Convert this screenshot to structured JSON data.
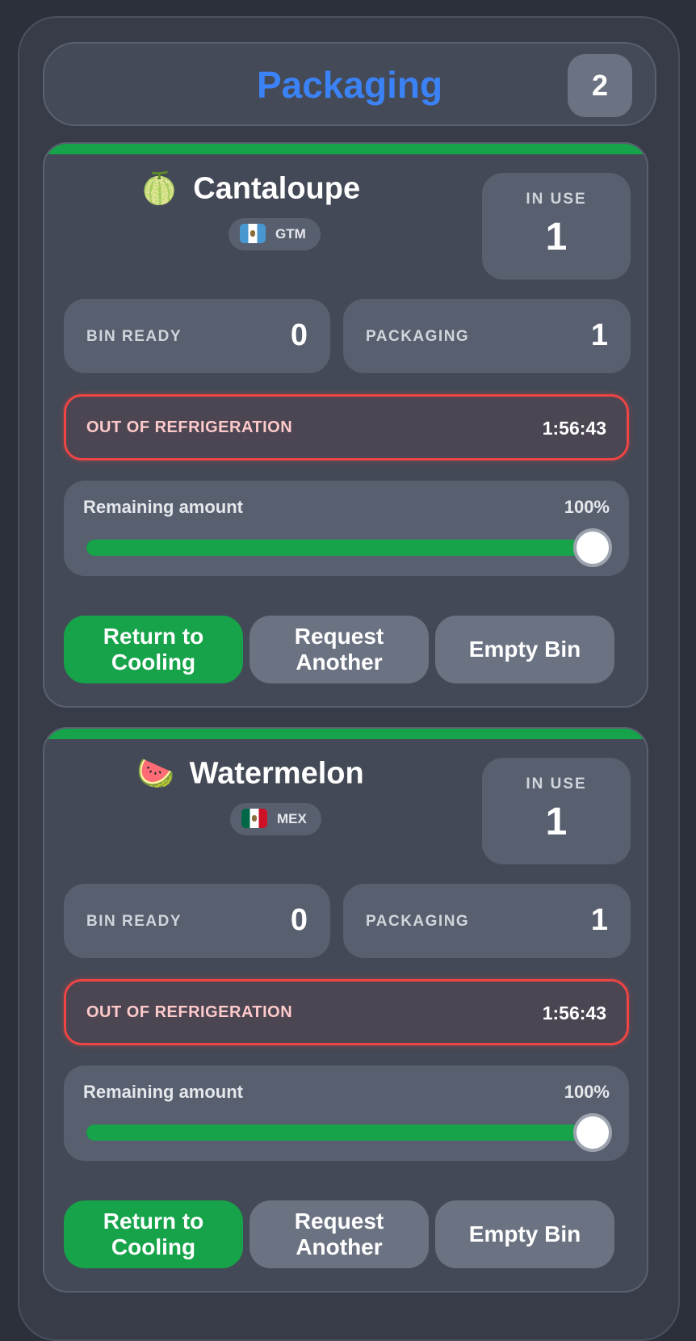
{
  "header": {
    "title": "Packaging",
    "count": "2",
    "title_color": "#3b82f6"
  },
  "colors": {
    "accent_green": "#16a34a",
    "alert_red": "#ef4444"
  },
  "cards": [
    {
      "icon": "cantaloupe-icon",
      "icon_glyph": "🍈",
      "name": "Cantaloupe",
      "origin_flag": "guatemala-flag-icon",
      "origin": "GTM",
      "in_use_label": "IN USE",
      "in_use_value": "1",
      "bin_ready_label": "BIN READY",
      "bin_ready_value": "0",
      "packaging_label": "PACKAGING",
      "packaging_value": "1",
      "oor_label": "OUT OF REFRIGERATION",
      "oor_time": "1:56:43",
      "remaining_label": "Remaining amount",
      "remaining_pct": "100%",
      "remaining_fraction": 1.0,
      "btn_return": "Return to Cooling",
      "btn_request": "Request Another",
      "btn_empty": "Empty Bin"
    },
    {
      "icon": "watermelon-icon",
      "icon_glyph": "🍉",
      "name": "Watermelon",
      "origin_flag": "mexico-flag-icon",
      "origin": "MEX",
      "in_use_label": "IN USE",
      "in_use_value": "1",
      "bin_ready_label": "BIN READY",
      "bin_ready_value": "0",
      "packaging_label": "PACKAGING",
      "packaging_value": "1",
      "oor_label": "OUT OF REFRIGERATION",
      "oor_time": "1:56:43",
      "remaining_label": "Remaining amount",
      "remaining_pct": "100%",
      "remaining_fraction": 1.0,
      "btn_return": "Return to Cooling",
      "btn_request": "Request Another",
      "btn_empty": "Empty Bin"
    }
  ]
}
